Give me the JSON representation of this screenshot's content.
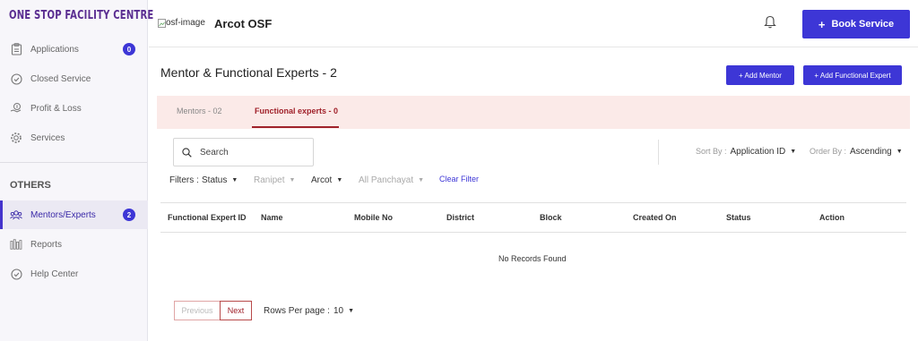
{
  "sidebar": {
    "brand": "ONE STOP FACILITY CENTRE",
    "items": [
      {
        "label": "Applications",
        "badge": "0",
        "icon": "clipboard-icon"
      },
      {
        "label": "Closed Service",
        "icon": "check-circle-icon"
      },
      {
        "label": "Profit & Loss",
        "icon": "money-hand-icon"
      },
      {
        "label": "Services",
        "icon": "gear-icon"
      }
    ],
    "section": "OTHERS",
    "others": [
      {
        "label": "Mentors/Experts",
        "badge": "2",
        "icon": "people-icon",
        "active": true
      },
      {
        "label": "Reports",
        "icon": "bar-chart-icon"
      },
      {
        "label": "Help Center",
        "icon": "check-circle-icon"
      }
    ]
  },
  "header": {
    "logo_alt": "osf-image",
    "app_name": "Arcot OSF",
    "book_label": "Book Service"
  },
  "main": {
    "title": "Mentor & Functional Experts -  2",
    "add_mentor": "+ Add Mentor",
    "add_expert": "+ Add Functional Expert",
    "tabs": [
      {
        "label": "Mentors - 02",
        "active": false
      },
      {
        "label": "Functional experts - 0",
        "active": true
      }
    ],
    "search_placeholder": "Search",
    "sort_by_label": "Sort By :",
    "sort_by_value": "Application ID",
    "order_by_label": "Order By :",
    "order_by_value": "Ascending",
    "filters_label": "Filters :",
    "filters": {
      "status": "Status",
      "district": "Ranipet",
      "block": "Arcot",
      "panchayat": "All Panchayat"
    },
    "clear_filter": "Clear Filter",
    "columns": [
      "Functional Expert ID",
      "Name",
      "Mobile No",
      "District",
      "Block",
      "Created On",
      "Status",
      "Action"
    ],
    "empty_text": "No Records Found",
    "pager": {
      "previous": "Previous",
      "next": "Next",
      "rows_label": "Rows Per page :",
      "rows_value": "10"
    }
  },
  "colors": {
    "brand": "#5a2d91",
    "accent": "#3d36d6",
    "tab_active": "#a0212a",
    "tab_bg": "#fbeae8"
  }
}
